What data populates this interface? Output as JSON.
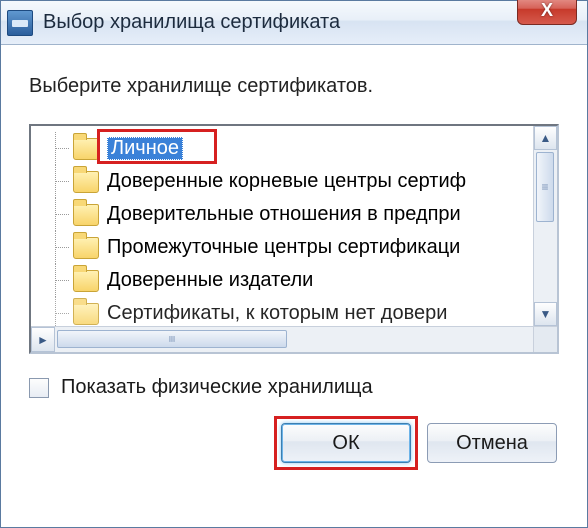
{
  "window": {
    "title": "Выбор хранилища сертификата",
    "close_icon": "X"
  },
  "dialog": {
    "instruction": "Выберите хранилище сертификатов."
  },
  "tree": {
    "items": [
      {
        "label": "Личное",
        "selected": true
      },
      {
        "label": "Доверенные корневые центры сертиф",
        "selected": false
      },
      {
        "label": "Доверительные отношения в предпри",
        "selected": false
      },
      {
        "label": "Промежуточные центры сертификаци",
        "selected": false
      },
      {
        "label": "Доверенные издатели",
        "selected": false
      },
      {
        "label": "Сертификаты, к которым нет довери",
        "selected": false
      }
    ]
  },
  "checkbox": {
    "label": "Показать физические хранилища",
    "checked": false
  },
  "buttons": {
    "ok": "ОК",
    "cancel": "Отмена"
  }
}
